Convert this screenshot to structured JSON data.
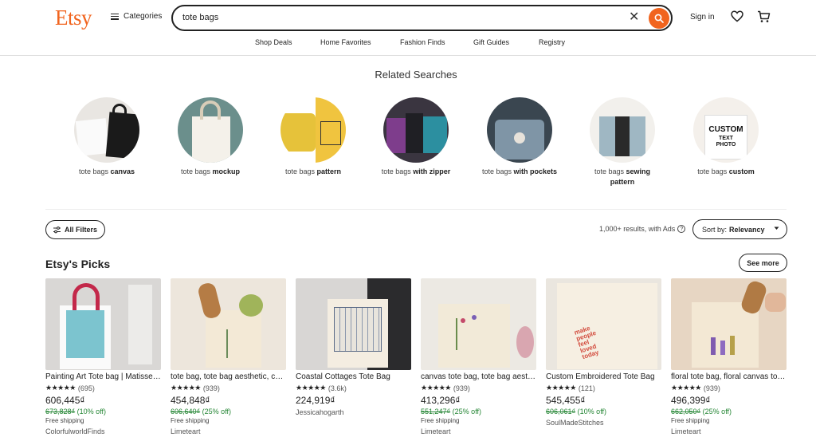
{
  "header": {
    "logo": "Etsy",
    "categories_label": "Categories",
    "search_value": "tote bags",
    "signin_label": "Sign in",
    "accent": "#f1641e"
  },
  "subnav": [
    "Shop Deals",
    "Home Favorites",
    "Fashion Finds",
    "Gift Guides",
    "Registry"
  ],
  "related": {
    "title": "Related Searches",
    "items": [
      {
        "base": "tote bags",
        "bold": "canvas",
        "bold2": ""
      },
      {
        "base": "tote bags",
        "bold": "mockup",
        "bold2": ""
      },
      {
        "base": "tote bags",
        "bold": "pattern",
        "bold2": ""
      },
      {
        "base": "tote bags",
        "bold": "with zipper",
        "bold2": ""
      },
      {
        "base": "tote bags",
        "bold": "with pockets",
        "bold2": ""
      },
      {
        "base": "tote bags",
        "bold": "sewing",
        "bold2": "pattern"
      },
      {
        "base": "tote bags",
        "bold": "custom",
        "bold2": ""
      }
    ]
  },
  "filters": {
    "all_filters_label": "All Filters",
    "results_text": "1,000+ results, with Ads",
    "sort_prefix": "Sort by:",
    "sort_value": "Relevancy"
  },
  "picks": {
    "title": "Etsy's Picks",
    "see_more_label": "See more"
  },
  "products": [
    {
      "title": "Painting Art Tote bag | Matisse Tote bag",
      "reviews": "(695)",
      "price": "606,445₫",
      "original": "673,828₫",
      "discount": "(10% off)",
      "shipping": "Free shipping",
      "shop": "ColorfulworldFinds"
    },
    {
      "title": "tote bag, tote bag aesthetic, canvas tote bag",
      "reviews": "(939)",
      "price": "454,848₫",
      "original": "606,640₫",
      "discount": "(25% off)",
      "shipping": "Free shipping",
      "shop": "Limeteart"
    },
    {
      "title": "Coastal Cottages Tote Bag",
      "reviews": "(3.6k)",
      "price": "224,919₫",
      "original": "",
      "discount": "",
      "shipping": "",
      "shop": "Jessicahogarth"
    },
    {
      "title": "canvas tote bag, tote bag aesthetic",
      "reviews": "(939)",
      "price": "413,296₫",
      "original": "551,247₫",
      "discount": "(25% off)",
      "shipping": "Free shipping",
      "shop": "Limeteart"
    },
    {
      "title": "Custom Embroidered Tote Bag",
      "reviews": "(121)",
      "price": "545,455₫",
      "original": "606,061₫",
      "discount": "(10% off)",
      "shipping": "",
      "shop": "SoulMadeStitches"
    },
    {
      "title": "floral tote bag, floral canvas tote bag",
      "reviews": "(939)",
      "price": "496,399₫",
      "original": "662,050₫",
      "discount": "(25% off)",
      "shipping": "Free shipping",
      "shop": "Limeteart"
    }
  ]
}
